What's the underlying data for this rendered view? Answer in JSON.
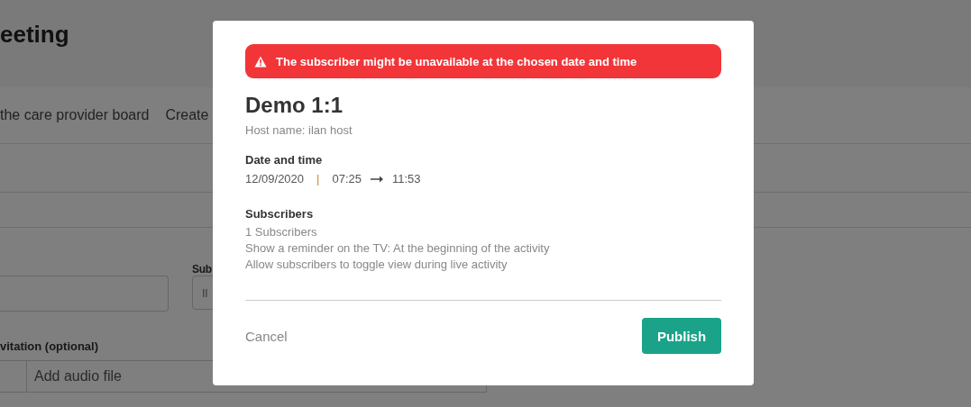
{
  "page": {
    "title": "eeting",
    "tabs": [
      {
        "label": "the care provider board"
      },
      {
        "label": "Create"
      }
    ],
    "subscriber_field": {
      "label": "Sub",
      "value": "Il"
    },
    "invitation": {
      "label": "vitation (optional)",
      "audio_placeholder": "Add audio file"
    }
  },
  "dialog": {
    "alert": "The subscriber might be unavailable at the chosen date and time",
    "title": "Demo 1:1",
    "host": "Host name: ilan host",
    "date_heading": "Date and time",
    "date": "12/09/2020",
    "separator": "|",
    "start": "07:25",
    "end": "11:53",
    "subscribers_heading": "Subscribers",
    "subscriber_lines": [
      "1 Subscribers",
      "Show a reminder on the TV: At the beginning of the activity",
      "Allow subscribers to toggle view during live activity"
    ],
    "cancel": "Cancel",
    "publish": "Publish"
  }
}
